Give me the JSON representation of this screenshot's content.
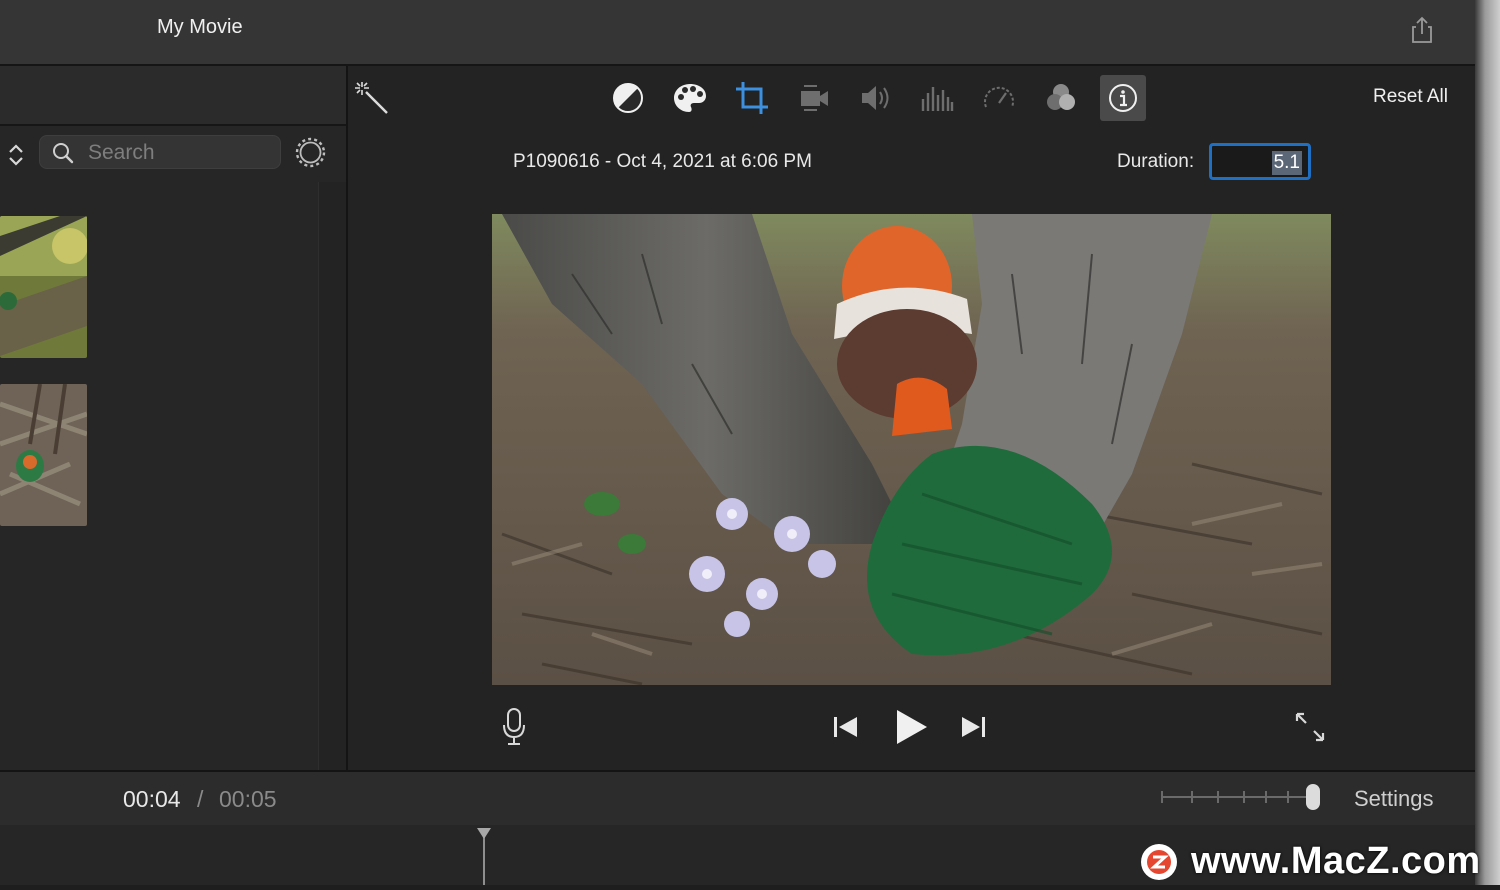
{
  "window": {
    "title": "My Movie"
  },
  "sidebar": {
    "search": {
      "placeholder": "Search",
      "value": ""
    }
  },
  "inspector": {
    "reset_label": "Reset All",
    "clip_title": "P1090616 - Oct 4, 2021 at 6:06 PM",
    "duration_label": "Duration:",
    "duration_value": "5.1",
    "tools": [
      {
        "name": "color-balance",
        "icon": "contrast-circle-icon"
      },
      {
        "name": "color-correction",
        "icon": "palette-icon"
      },
      {
        "name": "crop",
        "icon": "crop-icon",
        "selected": true
      },
      {
        "name": "stabilization",
        "icon": "video-camera-icon"
      },
      {
        "name": "volume",
        "icon": "speaker-icon"
      },
      {
        "name": "noise-reduction-eq",
        "icon": "equalizer-icon"
      },
      {
        "name": "speed",
        "icon": "speedometer-icon"
      },
      {
        "name": "clip-filter",
        "icon": "filter-circles-icon"
      },
      {
        "name": "clip-info",
        "icon": "info-icon",
        "active": true
      }
    ],
    "accent_color": "#3d8fe0"
  },
  "timeline": {
    "current_time": "00:04",
    "separator": "/",
    "total_time": "00:05",
    "settings_label": "Settings"
  },
  "watermark": {
    "text": "www.MacZ.com"
  }
}
